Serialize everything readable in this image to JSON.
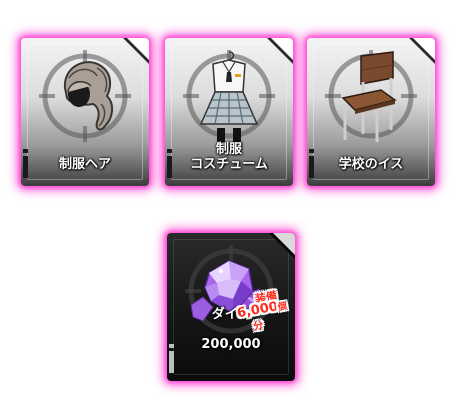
{
  "rewards": [
    {
      "label": "制服ヘア",
      "icon": "uniform-hair-icon"
    },
    {
      "label": "制服\nコスチューム",
      "icon": "uniform-costume-icon"
    },
    {
      "label": "学校のイス",
      "icon": "school-chair-icon"
    },
    {
      "label": "ダイヤ",
      "quantity": "200,000",
      "icon": "diamond-gem-icon"
    }
  ],
  "badge": {
    "line1": "装備",
    "line2_number": "6,000",
    "line2_unit": "個",
    "line3": "分"
  },
  "colors": {
    "glow": "#ff3cd2",
    "badge_text": "#ff2a1f",
    "gem": "#b46bf0"
  }
}
